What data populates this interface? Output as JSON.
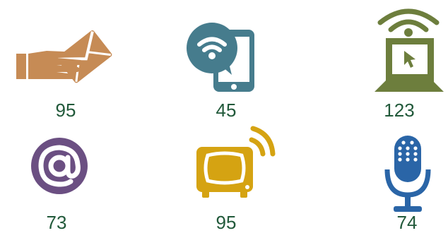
{
  "colors": {
    "mail": "#c68b55",
    "phone": "#467c8d",
    "laptop": "#6d7e3d",
    "email": "#6b4f82",
    "tv": "#d5a312",
    "mic": "#2a65a7",
    "number": "#21593a"
  },
  "items": [
    {
      "icon": "hand-envelope-icon",
      "value": "95"
    },
    {
      "icon": "phone-wifi-icon",
      "value": "45"
    },
    {
      "icon": "laptop-wifi-icon",
      "value": "123"
    },
    {
      "icon": "at-sign-icon",
      "value": "73"
    },
    {
      "icon": "tv-broadcast-icon",
      "value": "95"
    },
    {
      "icon": "microphone-icon",
      "value": "74"
    }
  ]
}
